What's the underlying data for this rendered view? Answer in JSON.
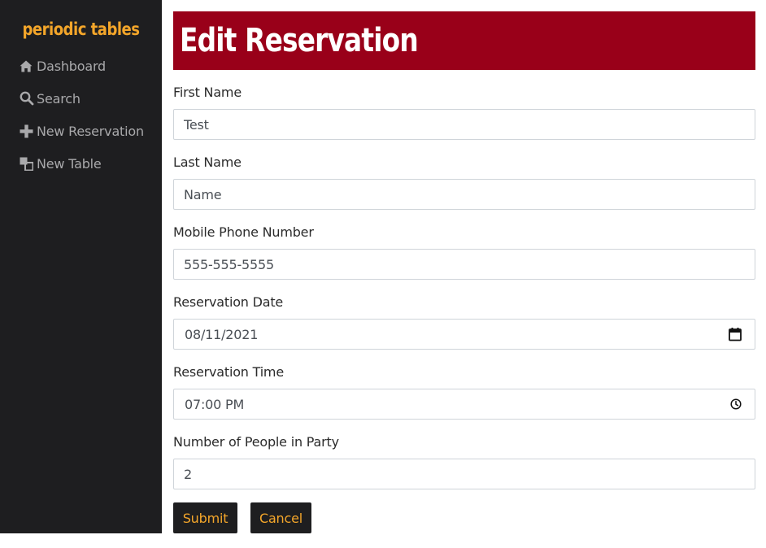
{
  "sidebar": {
    "brand": "periodic tables",
    "items": [
      {
        "label": "Dashboard",
        "icon": "home-icon"
      },
      {
        "label": "Search",
        "icon": "search-icon"
      },
      {
        "label": "New Reservation",
        "icon": "plus-icon"
      },
      {
        "label": "New Table",
        "icon": "tables-icon"
      }
    ]
  },
  "page": {
    "title": "Edit Reservation"
  },
  "form": {
    "first_name": {
      "label": "First Name",
      "value": "Test"
    },
    "last_name": {
      "label": "Last Name",
      "value": "Name"
    },
    "mobile_number": {
      "label": "Mobile Phone Number",
      "value": "555-555-5555"
    },
    "reservation_date": {
      "label": "Reservation Date",
      "value": "08/11/2021",
      "icon": "calendar-icon"
    },
    "reservation_time": {
      "label": "Reservation Time",
      "value": "07:00 PM",
      "icon": "clock-icon"
    },
    "people": {
      "label": "Number of People in Party",
      "value": "2"
    }
  },
  "buttons": {
    "submit": "Submit",
    "cancel": "Cancel"
  },
  "colors": {
    "sidebar_bg": "#1e1e20",
    "accent": "#f4a62a",
    "title_bg": "#990019",
    "nav_text": "#a9a9ab"
  }
}
